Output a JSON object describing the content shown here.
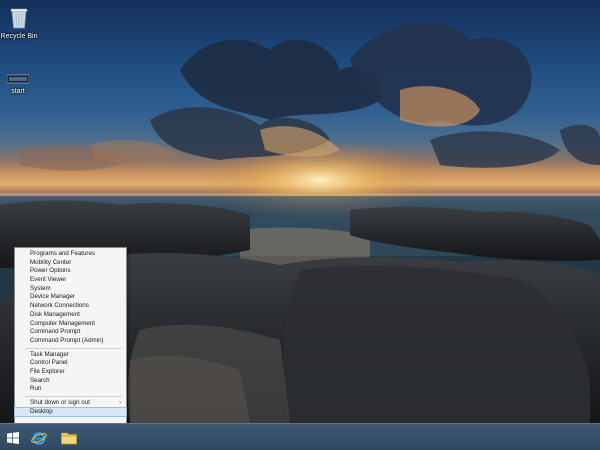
{
  "desktop": {
    "icons": [
      {
        "label": "Recycle Bin",
        "icon": "recycle-bin-icon"
      },
      {
        "label": "start",
        "icon": "shortcut-icon"
      }
    ]
  },
  "context_menu": {
    "groups": [
      [
        "Programs and Features",
        "Mobility Center",
        "Power Options",
        "Event Viewer",
        "System",
        "Device Manager",
        "Network Connections",
        "Disk Management",
        "Computer Management",
        "Command Prompt",
        "Command Prompt (Admin)"
      ],
      [
        "Task Manager",
        "Control Panel",
        "File Explorer",
        "Search",
        "Run"
      ],
      [
        "Shut down or sign out",
        "Desktop"
      ]
    ],
    "submenu_arrow": "›",
    "highlighted": "Desktop"
  },
  "taskbar": {
    "buttons": [
      {
        "icon": "windows-start-icon"
      },
      {
        "icon": "internet-explorer-icon"
      },
      {
        "icon": "file-explorer-folder-icon"
      }
    ]
  },
  "colors": {
    "taskbar": "#2f475f",
    "menu_bg": "#f5f5f5",
    "selection": "#d9e6f5"
  }
}
